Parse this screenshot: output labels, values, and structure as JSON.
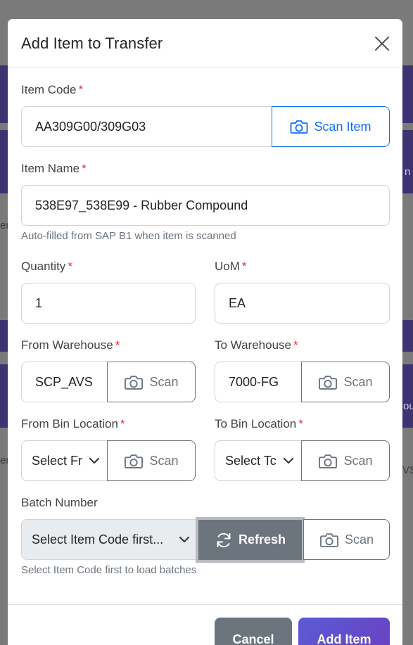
{
  "modal": {
    "title": "Add Item to Transfer"
  },
  "backdrop": {
    "edge_right_1": "n",
    "edge_left_1": "er",
    "edge_right_2": "ou",
    "edge_left_2": "er",
    "edge_right_3": "VS"
  },
  "item_code": {
    "label": "Item Code",
    "required_mark": "*",
    "value": "AA309G00/309G03",
    "scan_label": "Scan Item"
  },
  "item_name": {
    "label": "Item Name",
    "required_mark": "*",
    "value": "538E97_538E99 - Rubber Compound",
    "hint": "Auto-filled from SAP B1 when item is scanned"
  },
  "quantity": {
    "label": "Quantity",
    "required_mark": "*",
    "value": "1"
  },
  "uom": {
    "label": "UoM",
    "required_mark": "*",
    "value": "EA"
  },
  "from_warehouse": {
    "label": "From Warehouse",
    "required_mark": "*",
    "value": "SCP_AVS",
    "scan_label": "Scan"
  },
  "to_warehouse": {
    "label": "To Warehouse",
    "required_mark": "*",
    "value": "7000-FG",
    "scan_label": "Scan"
  },
  "from_bin": {
    "label": "From Bin Location",
    "required_mark": "*",
    "selected": "Select Fr",
    "scan_label": "Scan"
  },
  "to_bin": {
    "label": "To Bin Location",
    "required_mark": "*",
    "selected": "Select Tc",
    "scan_label": "Scan"
  },
  "batch": {
    "label": "Batch Number",
    "selected": "Select Item Code first...",
    "refresh_label": "Refresh",
    "scan_label": "Scan",
    "hint": "Select Item Code first to load batches"
  },
  "footer": {
    "cancel_label": "Cancel",
    "add_label": "Add Item"
  },
  "colors": {
    "primary": "#0d6efd",
    "secondary": "#6c757d",
    "required": "#dc3545",
    "add_button_gradient_start": "#5b5bd6",
    "add_button_gradient_end": "#6a3fc0"
  }
}
